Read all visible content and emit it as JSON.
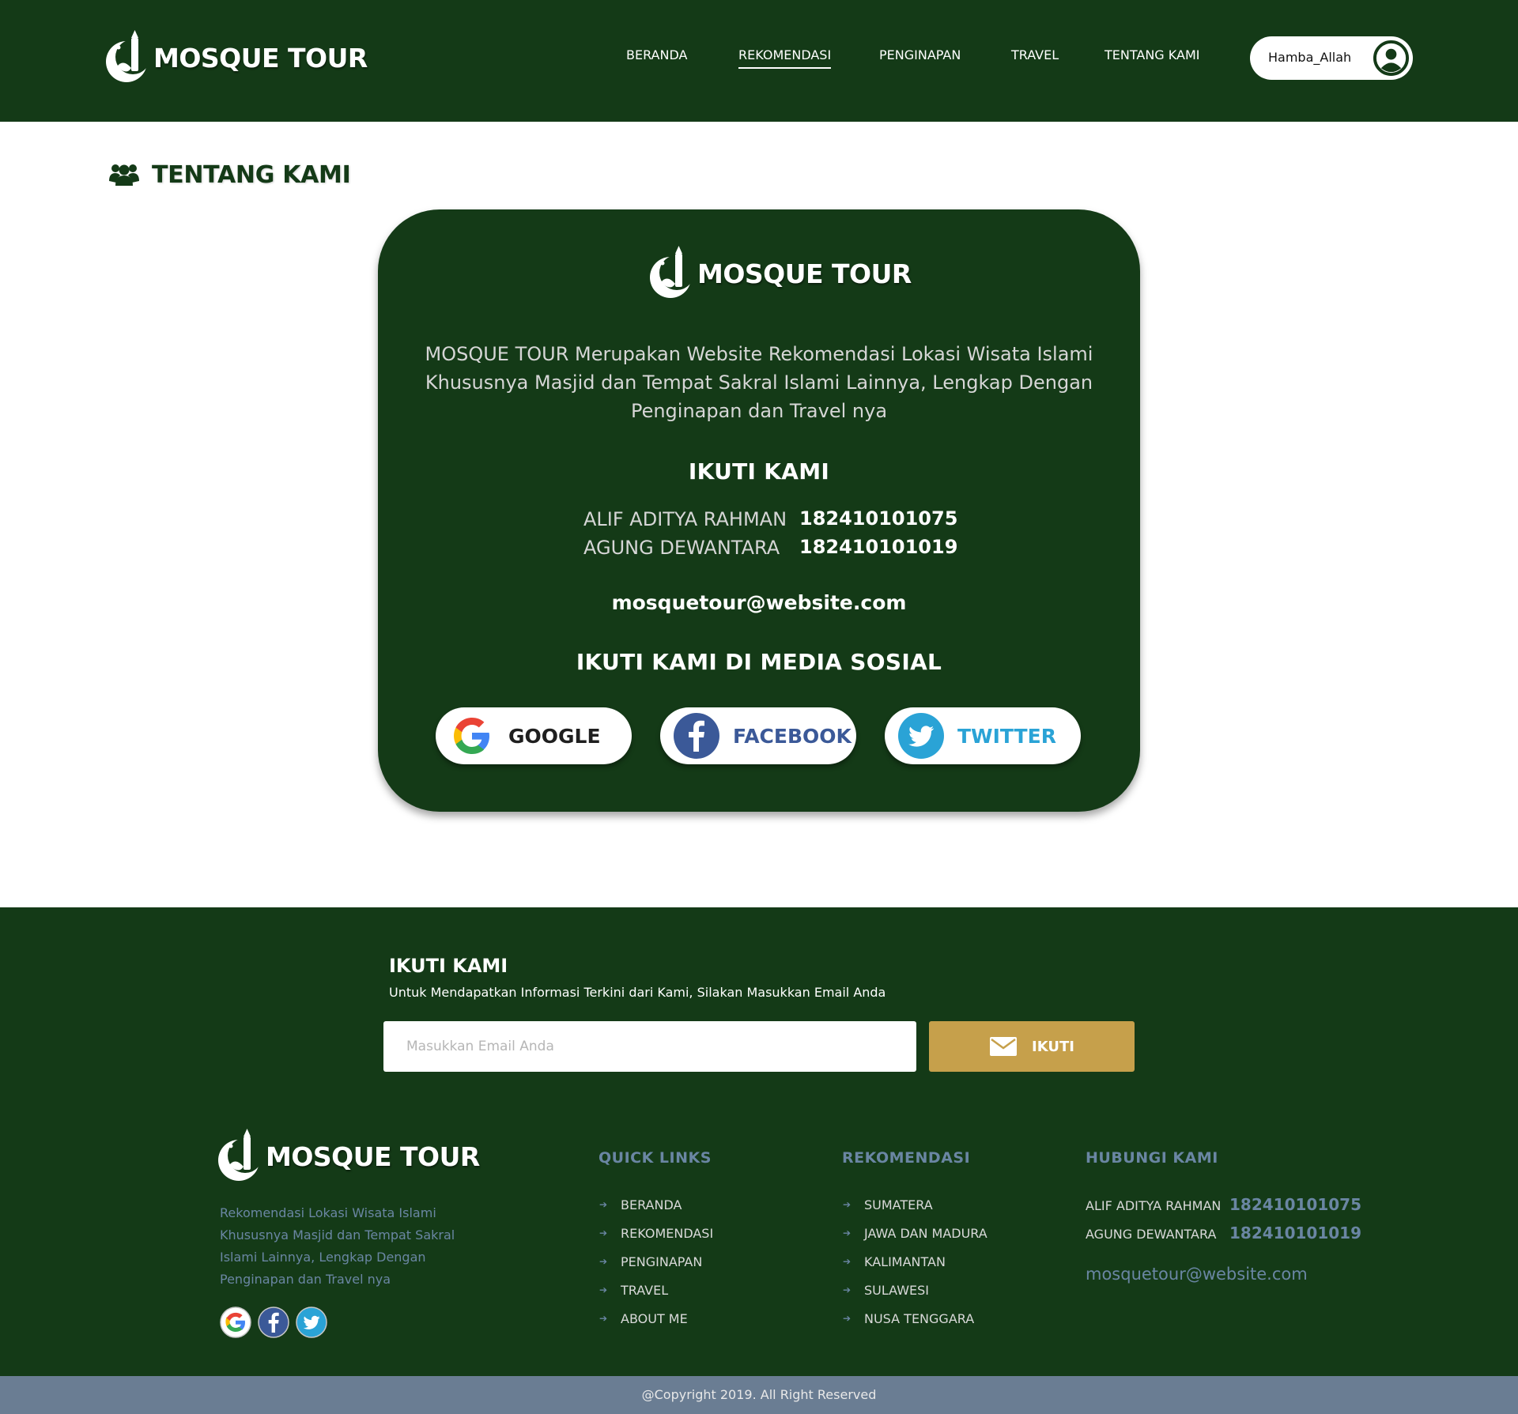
{
  "header": {
    "logo_text": "MOSQUE TOUR",
    "nav": [
      {
        "label": "BERANDA",
        "active": false
      },
      {
        "label": "REKOMENDASI",
        "active": true
      },
      {
        "label": "PENGINAPAN",
        "active": false
      },
      {
        "label": "TRAVEL",
        "active": false
      },
      {
        "label": "TENTANG KAMI",
        "active": false
      }
    ],
    "username": "Hamba_Allah"
  },
  "page": {
    "title": "TENTANG KAMI"
  },
  "about": {
    "logo_text": "MOSQUE TOUR",
    "description": "MOSQUE TOUR Merupakan Website Rekomendasi Lokasi Wisata Islami Khususnya Masjid dan Tempat Sakral Islami Lainnya, Lengkap Dengan Penginapan dan Travel nya",
    "follow_title": "IKUTI KAMI",
    "contacts": [
      {
        "name": "ALIF ADITYA RAHMAN",
        "number": "182410101075"
      },
      {
        "name": "AGUNG DEWANTARA",
        "number": "182410101019"
      }
    ],
    "email": "mosquetour@website.com",
    "social_title": "IKUTI KAMI DI MEDIA SOSIAL",
    "social_buttons": [
      {
        "label": "GOOGLE",
        "icon": "google-icon",
        "color": "#1f1f1f"
      },
      {
        "label": "FACEBOOK",
        "icon": "facebook-icon",
        "color": "#3b5998"
      },
      {
        "label": "TWITTER",
        "icon": "twitter-icon",
        "color": "#2aa3d6"
      }
    ]
  },
  "subscribe": {
    "title": "IKUTI KAMI",
    "subtitle": "Untuk Mendapatkan Informasi Terkini dari Kami, Silakan Masukkan Email Anda",
    "placeholder": "Masukkan Email Anda",
    "button_label": "IKUTI"
  },
  "footer": {
    "logo_text": "MOSQUE TOUR",
    "description": "Rekomendasi Lokasi Wisata Islami Khususnya Masjid dan Tempat Sakral Islami Lainnya, Lengkap Dengan Penginapan dan Travel nya",
    "columns": [
      {
        "title": "QUICK LINKS",
        "items": [
          "BERANDA",
          "REKOMENDASI",
          "PENGINAPAN",
          "TRAVEL",
          "ABOUT ME"
        ]
      },
      {
        "title": "REKOMENDASI",
        "items": [
          "SUMATERA",
          "JAWA DAN MADURA",
          "KALIMANTAN",
          "SULAWESI",
          "NUSA TENGGARA"
        ]
      }
    ],
    "contact_title": "HUBUNGI KAMI",
    "contacts": [
      {
        "name": "ALIF ADITYA RAHMAN",
        "number": "182410101075"
      },
      {
        "name": "AGUNG DEWANTARA",
        "number": "182410101019"
      }
    ],
    "email": "mosquetour@website.com",
    "copyright": "@Copyright 2019. All Right Reserved"
  },
  "colors": {
    "primary_green": "#143a17",
    "gold": "#c6a04b",
    "muted_blue": "#6a86a3",
    "copyright_bar": "#6a7d93"
  }
}
